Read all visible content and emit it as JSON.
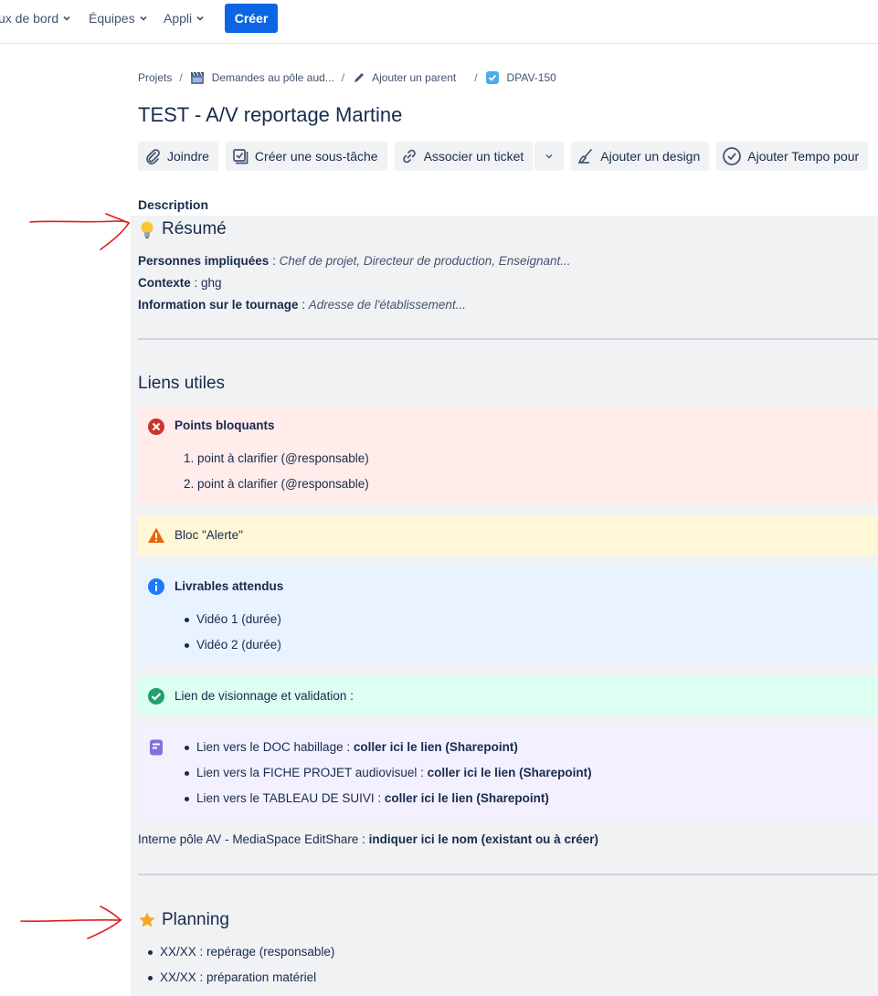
{
  "nav": {
    "items": [
      {
        "label": "ux de bord"
      },
      {
        "label": "Équipes"
      },
      {
        "label": "Appli"
      }
    ],
    "create_label": "Créer"
  },
  "breadcrumb": {
    "projects": "Projets",
    "project": "Demandes au pôle aud...",
    "add_parent": "Ajouter un parent",
    "issue_key": "DPAV-150"
  },
  "issue": {
    "title": "TEST - A/V reportage Martine"
  },
  "toolbar": {
    "attach": "Joindre",
    "subtask": "Créer une sous-tâche",
    "link": "Associer un ticket",
    "design": "Ajouter un design",
    "tempo": "Ajouter Tempo pour"
  },
  "description": {
    "label": "Description",
    "resume": {
      "heading": "Résumé",
      "persons_label": "Personnes impliquées",
      "persons_value": "Chef de projet, Directeur de production, Enseignant...",
      "context_label": "Contexte",
      "context_value": "ghg",
      "shoot_label": "Information sur le tournage",
      "shoot_value": "Adresse de l'établissement..."
    },
    "liens": {
      "heading": "Liens utiles",
      "blocking": {
        "title": "Points bloquants",
        "items": [
          "point à clarifier (@responsable)",
          "point à clarifier (@responsable)"
        ]
      },
      "alert": {
        "title": "Bloc \"Alerte\""
      },
      "deliverables": {
        "title": "Livrables attendus",
        "items": [
          "Vidéo 1 (durée)",
          "Vidéo 2 (durée)"
        ]
      },
      "validation": {
        "title": "Lien de visionnage et validation :"
      },
      "links": [
        {
          "prefix": "Lien vers le DOC habillage : ",
          "bold": "coller ici le lien (Sharepoint)"
        },
        {
          "prefix": "Lien vers la FICHE PROJET audiovisuel : ",
          "bold": "coller ici le lien (Sharepoint)"
        },
        {
          "prefix": "Lien vers le TABLEAU DE SUIVI : ",
          "bold": "coller ici le lien (Sharepoint)"
        }
      ],
      "internal_prefix": "Interne pôle AV - MediaSpace EditShare : ",
      "internal_bold": "indiquer ici le nom (existant ou à créer)"
    },
    "planning": {
      "heading": "Planning",
      "items": [
        "XX/XX : repérage (responsable)",
        "XX/XX : préparation matériel"
      ]
    }
  },
  "colors": {
    "primary": "#0c66e4",
    "red_panel": "#ffeceb",
    "yellow_panel": "#fff7d6",
    "blue_panel": "#e9f2ff",
    "green_panel": "#dcfff1",
    "purple_panel": "#f3f0ff",
    "annotation_arrow": "#e01b1b"
  }
}
